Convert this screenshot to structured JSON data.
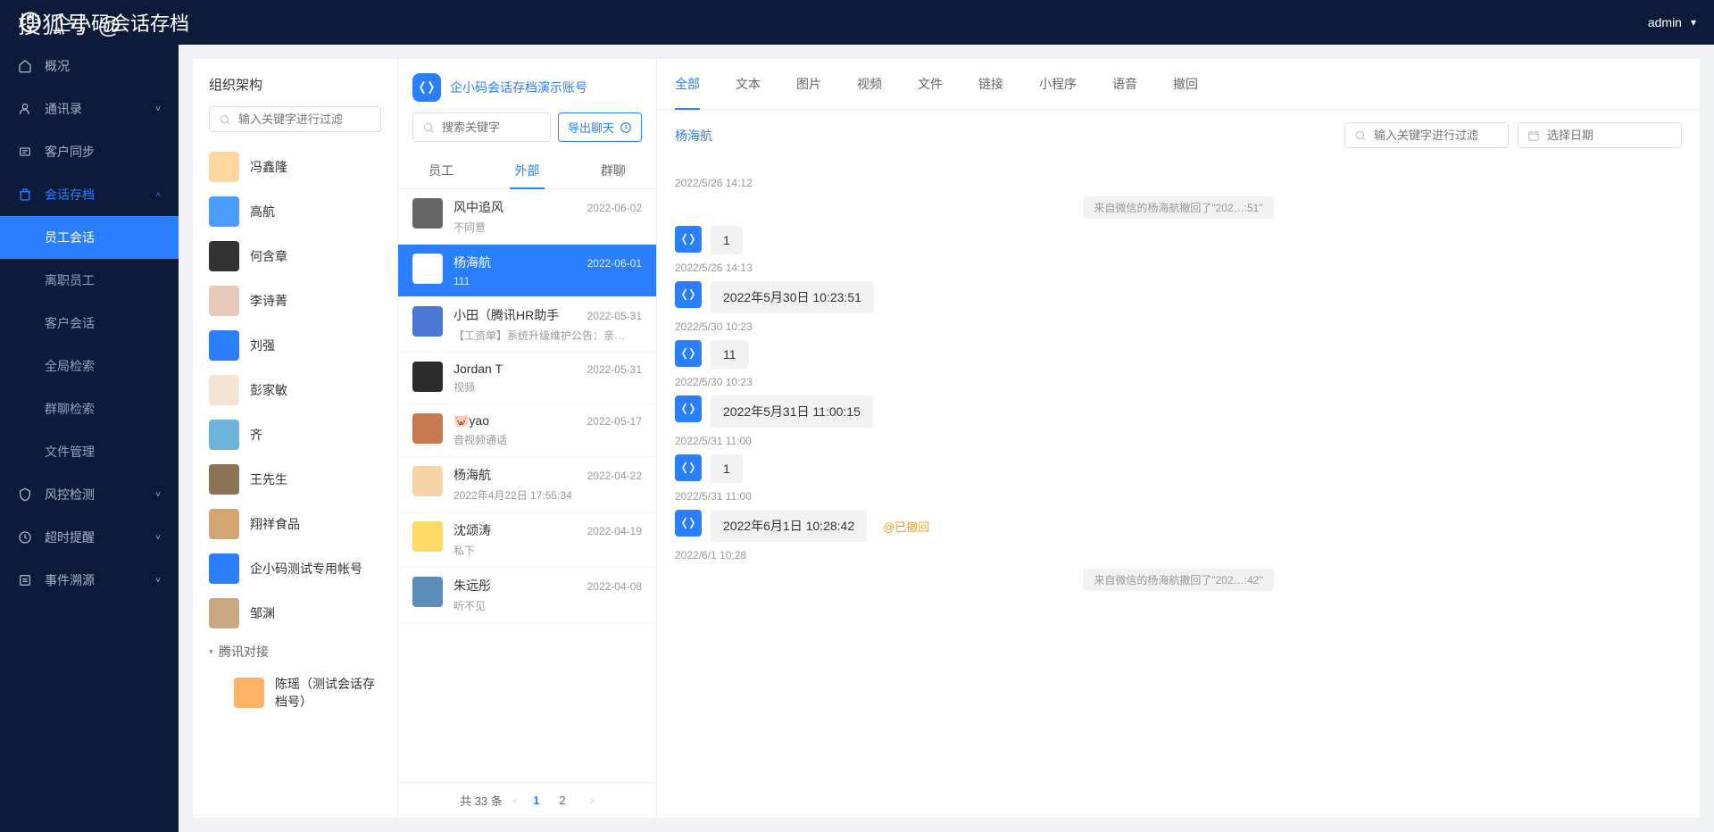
{
  "watermark": "搜狐号 @",
  "app_title": "企小码会话存档",
  "user_menu": "admin",
  "sidebar": {
    "items": [
      {
        "label": "概况",
        "icon": "home"
      },
      {
        "label": "通讯录",
        "icon": "user",
        "expandable": true
      },
      {
        "label": "客户同步",
        "icon": "sync"
      },
      {
        "label": "会话存档",
        "icon": "archive",
        "active": true,
        "expanded": true,
        "children": [
          {
            "label": "员工会话",
            "active": true
          },
          {
            "label": "离职员工"
          },
          {
            "label": "客户会话"
          },
          {
            "label": "全局检索"
          },
          {
            "label": "群聊检索"
          },
          {
            "label": "文件管理"
          }
        ]
      },
      {
        "label": "风控检测",
        "icon": "shield",
        "expandable": true
      },
      {
        "label": "超时提醒",
        "icon": "clock",
        "expandable": true
      },
      {
        "label": "事件溯源",
        "icon": "event",
        "expandable": true
      }
    ]
  },
  "org": {
    "title": "组织架构",
    "search_placeholder": "输入关键字进行过滤",
    "members": [
      {
        "name": "冯鑫隆"
      },
      {
        "name": "高航"
      },
      {
        "name": "何含章"
      },
      {
        "name": "李诗菁"
      },
      {
        "name": "刘强"
      },
      {
        "name": "彭家敏"
      },
      {
        "name": "齐"
      },
      {
        "name": "王先生"
      },
      {
        "name": "翔祥食品"
      },
      {
        "name": "企小码测试专用帐号"
      },
      {
        "name": "邹渊"
      }
    ],
    "tree_node": "腾讯对接",
    "tree_child": "陈瑶（测试会话存档号）"
  },
  "conv": {
    "app_name": "企小码会话存档演示账号",
    "search_placeholder": "搜索关键字",
    "export_label": "导出聊天",
    "tabs": [
      "员工",
      "外部",
      "群聊"
    ],
    "active_tab": 1,
    "list": [
      {
        "name": "风中追风",
        "date": "2022-06-02",
        "preview": "不同意"
      },
      {
        "name": "杨海航",
        "date": "2022-06-01",
        "preview": "111",
        "active": true
      },
      {
        "name": "小田（腾讯HR助手",
        "date": "2022-05-31",
        "preview": "【工资单】系统升级维护公告：亲…"
      },
      {
        "name": "Jordan T",
        "date": "2022-05-31",
        "preview": "视频"
      },
      {
        "name": "🐷yao",
        "date": "2022-05-17",
        "preview": "音视频通话"
      },
      {
        "name": "杨海航",
        "date": "2022-04-22",
        "preview": "2022年4月22日 17:55:34"
      },
      {
        "name": "沈颂涛",
        "date": "2022-04-19",
        "preview": "私下"
      },
      {
        "name": "朱远彤",
        "date": "2022-04-08",
        "preview": "听不见"
      }
    ],
    "pager": {
      "total_label": "共 33 条",
      "pages": [
        "1",
        "2"
      ],
      "current": 0
    }
  },
  "chat": {
    "tabs": [
      "全部",
      "文本",
      "图片",
      "视频",
      "文件",
      "链接",
      "小程序",
      "语音",
      "撤回"
    ],
    "active_tab": 0,
    "title": "杨海航",
    "filter_placeholder": "输入关键字进行过滤",
    "date_placeholder": "选择日期",
    "messages": [
      {
        "type": "time",
        "text": "2022/5/26 14:12"
      },
      {
        "type": "recall",
        "text": "来自微信的杨海航撤回了\"202…:51\""
      },
      {
        "type": "msg",
        "text": "1"
      },
      {
        "type": "time",
        "text": "2022/5/26 14:13"
      },
      {
        "type": "msg",
        "text": "2022年5月30日 10:23:51"
      },
      {
        "type": "time",
        "text": "2022/5/30 10:23"
      },
      {
        "type": "msg",
        "text": "11"
      },
      {
        "type": "time",
        "text": "2022/5/30 10:23"
      },
      {
        "type": "msg",
        "text": "2022年5月31日 11:00:15"
      },
      {
        "type": "time",
        "text": "2022/5/31 11:00"
      },
      {
        "type": "msg",
        "text": "1"
      },
      {
        "type": "time",
        "text": "2022/5/31 11:00"
      },
      {
        "type": "msg",
        "text": "2022年6月1日 10:28:42",
        "recalled": true,
        "recalled_label": "已撤回"
      },
      {
        "type": "time",
        "text": "2022/6/1 10:28"
      },
      {
        "type": "recall",
        "text": "来自微信的杨海航撤回了\"202…:42\""
      }
    ]
  }
}
